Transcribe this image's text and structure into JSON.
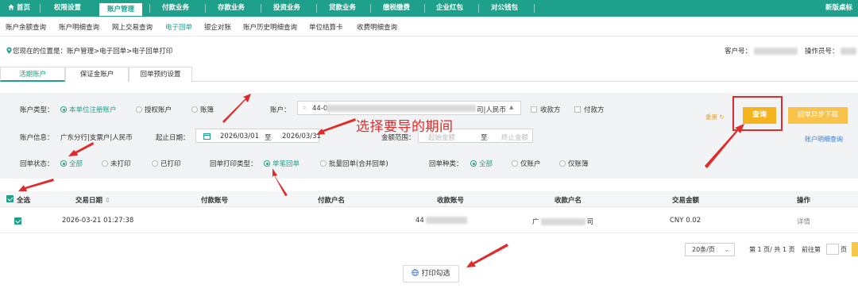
{
  "topnav": {
    "items": [
      "首页",
      "权限设置",
      "账户管理",
      "付款业务",
      "存款业务",
      "投资业务",
      "贷款业务",
      "缴税缴费",
      "企业红包",
      "对公钱包"
    ],
    "right": "新版桌标",
    "active_index": 2
  },
  "subnav": {
    "items": [
      "账户余额查询",
      "账户明细查询",
      "网上交易查询",
      "电子回单",
      "银企对账",
      "账户历史明细查询",
      "单位结算卡",
      "收费明细查询"
    ],
    "active_index": 3
  },
  "breadcrumb": "您现在的位置是：账户管理>电子回单>电子回单打印",
  "account_info": {
    "customer_label": "客户号：",
    "operator_label": "操作员号："
  },
  "tabs": [
    "活期账户",
    "保证金账户",
    "回单预约设置"
  ],
  "filter": {
    "acct_type_label": "账户类型：",
    "acct_type_options": [
      "本单位注册账户",
      "授权账户",
      "账簿"
    ],
    "account_label": "账户：",
    "account_prefix": "44-0",
    "account_suffix": "司|人民币",
    "payer_label": "收款方",
    "payee_label": "付款方",
    "acct_info_label": "账户信息：",
    "acct_info_value": "广东分行|支票户|人民币",
    "start_date_label": "起止日期：",
    "start_date": "2026/03/01",
    "to_label": "至",
    "end_date": "2026/03/31",
    "amount_label": "金额范围：",
    "amount_from_ph": "起始金额",
    "amount_to_ph": "终止金额",
    "status_label": "回单状态：",
    "status_options": [
      "全部",
      "未打印",
      "已打印"
    ],
    "print_type_label": "回单打印类型：",
    "print_type_options": [
      "单笔回单",
      "批量回单(合并回单)"
    ],
    "receipt_type_label": "回单种类：",
    "receipt_type_options": [
      "全部",
      "仅账户",
      "仅账簿"
    ],
    "reset": "重置",
    "query": "查询",
    "async_download": "回单异步下载",
    "detail_link": "账户明细查询"
  },
  "annotation": "选择要导的期间",
  "table": {
    "select_all": "全选",
    "headers": [
      "交易日期",
      "付款账号",
      "付款户名",
      "收款账号",
      "收款户名",
      "交易金额",
      "操作"
    ],
    "rows": [
      {
        "date": "2026-03-21 01:27:38",
        "payer_acct": "",
        "payer_name": "",
        "payee_acct": "44",
        "payee_name_start": "广",
        "payee_name_end": "司",
        "amount": "CNY 0.02",
        "action": "详情"
      }
    ]
  },
  "pager": {
    "page_size": "20条/页",
    "page_info": "第 1 页/ 共 1 页",
    "goto": "前往第",
    "page_unit": "页"
  },
  "print_button": "打印勾选",
  "colors": {
    "brand": "#1ea08a",
    "query": "#f5b31f",
    "annotation": "#e12b2b"
  }
}
